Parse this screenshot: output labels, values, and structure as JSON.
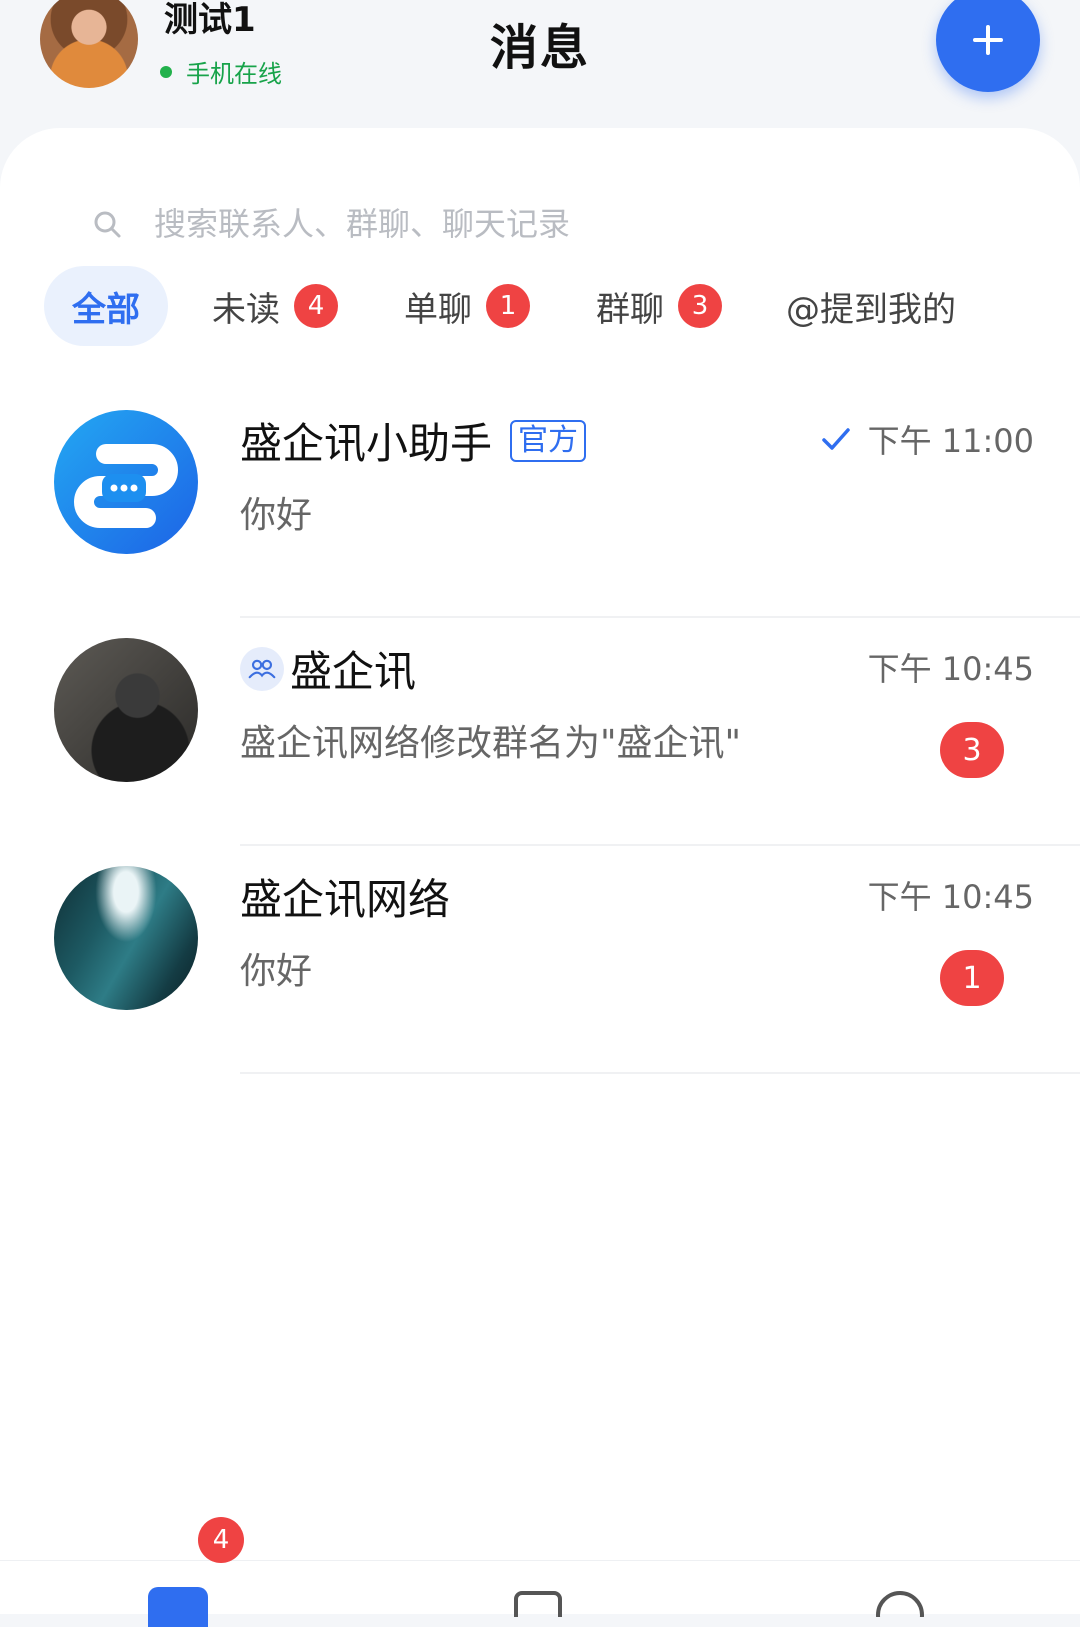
{
  "user": {
    "name": "测试1",
    "status": "手机在线"
  },
  "header": {
    "title": "消息"
  },
  "search": {
    "placeholder": "搜索联系人、群聊、聊天记录"
  },
  "tabs": [
    {
      "label": "全部",
      "badge": ""
    },
    {
      "label": "未读",
      "badge": "4"
    },
    {
      "label": "单聊",
      "badge": "1"
    },
    {
      "label": "群聊",
      "badge": "3"
    },
    {
      "label": "@提到我的",
      "badge": ""
    }
  ],
  "conversations": [
    {
      "name": "盛企讯小助手",
      "tag": "官方",
      "time": "下午 11:00",
      "preview": "你好",
      "unread": ""
    },
    {
      "name": "盛企讯",
      "tag": "",
      "time": "下午 10:45",
      "preview": "盛企讯网络修改群名为\"盛企讯\"",
      "unread": "3"
    },
    {
      "name": "盛企讯网络",
      "tag": "",
      "time": "下午 10:45",
      "preview": "你好",
      "unread": "1"
    }
  ],
  "bottom_nav": {
    "messages_badge": "4"
  },
  "colors": {
    "accent": "#2f6ef0",
    "badge": "#ef4343",
    "online": "#22b14c"
  },
  "icons": [
    "plus-icon",
    "search-icon",
    "check-icon",
    "group-icon"
  ]
}
